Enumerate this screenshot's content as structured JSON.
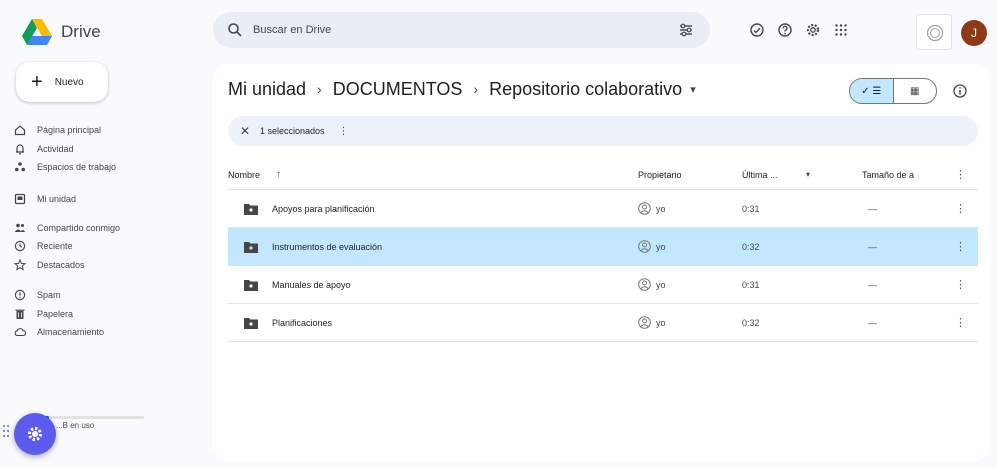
{
  "app": {
    "name": "Drive"
  },
  "search": {
    "placeholder": "Buscar en Drive"
  },
  "account": {
    "initial": "J"
  },
  "sidebar": {
    "new_label": "Nuevo",
    "items": [
      {
        "label": "Página principal",
        "icon": "home-icon"
      },
      {
        "label": "Actividad",
        "icon": "activity-icon"
      },
      {
        "label": "Espacios de trabajo",
        "icon": "workspaces-icon"
      },
      {
        "label": "Mi unidad",
        "icon": "my-drive-icon"
      },
      {
        "label": "Compartido conmigo",
        "icon": "shared-icon"
      },
      {
        "label": "Reciente",
        "icon": "clock-icon"
      },
      {
        "label": "Destacados",
        "icon": "star-icon"
      },
      {
        "label": "Spam",
        "icon": "spam-icon"
      },
      {
        "label": "Papelera",
        "icon": "trash-icon"
      },
      {
        "label": "Almacenamiento",
        "icon": "cloud-icon"
      }
    ],
    "storage_text": "...B en uso",
    "storage_fraction": 0.05
  },
  "breadcrumb": {
    "items": [
      "Mi unidad",
      "DOCUMENTOS",
      "Repositorio colaborativo"
    ],
    "separator": "›",
    "caret": "▾"
  },
  "view": {
    "list_label": "✓ ☰",
    "grid_label": "▦"
  },
  "selection": {
    "text": "1 seleccionados",
    "close": "✕",
    "more": "⋮"
  },
  "table": {
    "columns": {
      "name": "Nombre",
      "sort_arrow": "↑",
      "owner": "Propietario",
      "modified": "Última ...",
      "modified_caret": "▾",
      "size": "Tamaño de a",
      "more": "⋮"
    },
    "rows": [
      {
        "name": "Apoyos para planificación",
        "owner": "yo",
        "modified": "0:31",
        "size": "—",
        "more": "⋮",
        "selected": false
      },
      {
        "name": "Instrumentos de evaluación",
        "owner": "yo",
        "modified": "0:32",
        "size": "—",
        "more": "⋮",
        "selected": true
      },
      {
        "name": "Manuales de apoyo",
        "owner": "yo",
        "modified": "0:31",
        "size": "—",
        "more": "⋮",
        "selected": false
      },
      {
        "name": "Planificaciones",
        "owner": "yo",
        "modified": "0:32",
        "size": "—",
        "more": "⋮",
        "selected": false
      }
    ]
  },
  "colors": {
    "selected_row": "#c2e7ff",
    "fab": "#5b5bf0",
    "avatar": "#8d3a16"
  }
}
